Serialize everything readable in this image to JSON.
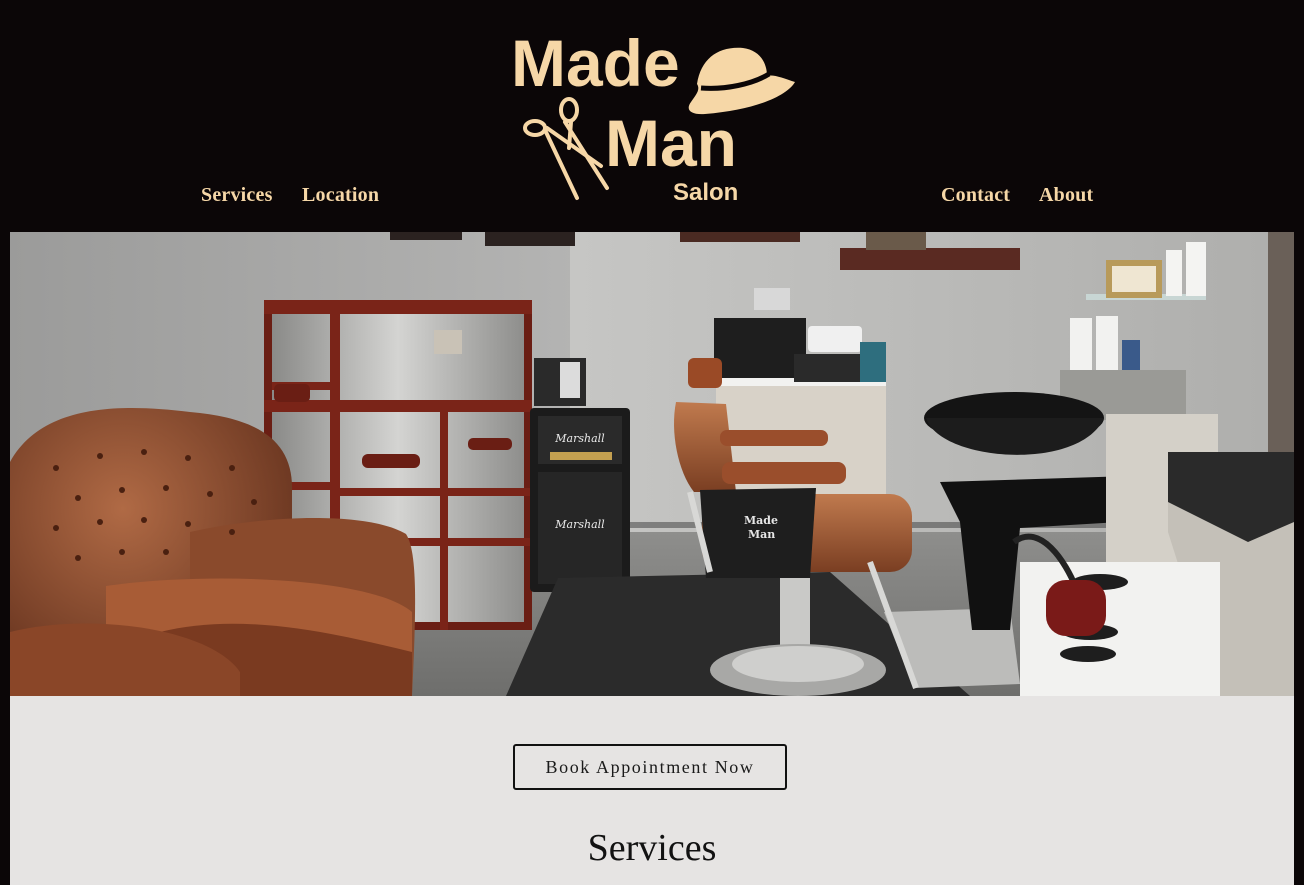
{
  "header": {
    "logo": {
      "line1": "Made",
      "line2": "Man",
      "line3": "Salon",
      "icons": [
        "fedora-hat-icon",
        "scissors-icon"
      ]
    },
    "nav_left": [
      {
        "label": "Services"
      },
      {
        "label": "Location"
      }
    ],
    "nav_right": [
      {
        "label": "Contact"
      },
      {
        "label": "About"
      }
    ]
  },
  "hero": {
    "apron_line1": "Made",
    "apron_line2": "Man",
    "amp_brand": "Marshall"
  },
  "main": {
    "book_button_label": "Book Appointment Now",
    "section_title": "Services"
  },
  "colors": {
    "header_bg": "#0b0607",
    "accent_cream": "#f6d7a7",
    "content_bg": "#e6e4e3",
    "leather": "#8a4a2c"
  }
}
